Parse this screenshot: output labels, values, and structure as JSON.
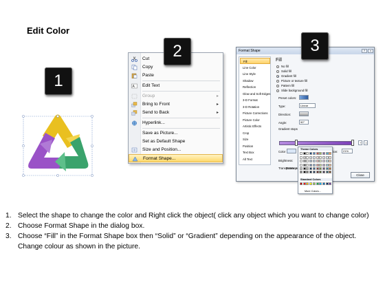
{
  "slide": {
    "title": "Edit Color"
  },
  "badges": [
    "1",
    "2",
    "3"
  ],
  "context_menu": {
    "items": [
      {
        "label": "Cut",
        "icon": "scissors-icon",
        "ul": true,
        "submenu": false,
        "disabled": false,
        "highlighted": false
      },
      {
        "label": "Copy",
        "icon": "copy-icon",
        "submenu": false,
        "disabled": false,
        "highlighted": false
      },
      {
        "label": "Paste",
        "icon": "paste-icon",
        "submenu": false,
        "disabled": false,
        "highlighted": false
      },
      {
        "label": "Edit Text",
        "icon": "edit-text-icon",
        "submenu": false,
        "disabled": false,
        "highlighted": false
      },
      {
        "label": "Group",
        "icon": "group-icon",
        "submenu": true,
        "disabled": true,
        "highlighted": false
      },
      {
        "label": "Bring to Front",
        "icon": "bring-to-front-icon",
        "submenu": true,
        "disabled": false,
        "highlighted": false
      },
      {
        "label": "Send to Back",
        "icon": "send-to-back-icon",
        "submenu": true,
        "disabled": false,
        "highlighted": false
      },
      {
        "label": "Hyperlink...",
        "icon": "hyperlink-icon",
        "submenu": false,
        "disabled": false,
        "highlighted": false
      },
      {
        "label": "Save as Picture...",
        "icon": "",
        "submenu": false,
        "disabled": false,
        "highlighted": false
      },
      {
        "label": "Set as Default Shape",
        "icon": "",
        "submenu": false,
        "disabled": false,
        "highlighted": false
      },
      {
        "label": "Size and Position...",
        "icon": "size-position-icon",
        "submenu": false,
        "disabled": false,
        "highlighted": false
      },
      {
        "label": "Format Shape...",
        "icon": "format-shape-icon",
        "submenu": false,
        "disabled": false,
        "highlighted": true
      }
    ]
  },
  "format_dialog": {
    "title": "Format Shape",
    "nav": [
      "Fill",
      "Line Color",
      "Line Style",
      "Shadow",
      "Reflection",
      "Glow and Soft Edges",
      "3-D Format",
      "3-D Rotation",
      "Picture Corrections",
      "Picture Color",
      "Artistic Effects",
      "Crop",
      "Size",
      "Position",
      "Text Box",
      "Alt Text"
    ],
    "nav_selected": 0,
    "heading": "Fill",
    "fill_options": [
      "No fill",
      "Solid fill",
      "Gradient fill",
      "Picture or texture fill",
      "Pattern fill",
      "Slide background fill"
    ],
    "fill_selected": 2,
    "labels": {
      "preset": "Preset colors:",
      "type": "Type:",
      "type_value": "Linear",
      "direction": "Direction:",
      "angle": "Angle:",
      "angle_value": "90°",
      "gradient_stops": "Gradient stops",
      "color": "Color",
      "position": "Position:",
      "position_value": "21%",
      "brightness": "Brightness:",
      "transparency": "Transparency:",
      "rotate": "Rotate with shape",
      "close": "Close"
    }
  },
  "theme_palette": {
    "theme_header": "Theme Colors",
    "standard_header": "Standard Colors",
    "more": "More Colors...",
    "theme_top": [
      "#ffffff",
      "#000000",
      "#eeece1",
      "#1f497d",
      "#4f81bd",
      "#c0504d",
      "#9bbb59",
      "#8064a2",
      "#4bacc6",
      "#f79646"
    ],
    "standard": [
      "#c00000",
      "#ff0000",
      "#ffc000",
      "#ffff00",
      "#92d050",
      "#00b050",
      "#00b0f0",
      "#0070c0",
      "#002060",
      "#7030a0"
    ]
  },
  "instructions": [
    {
      "num": "1.",
      "text": "Select the shape to change the color and Right click the object( click any object which you want to change color)"
    },
    {
      "num": "2.",
      "text": "Choose Format Shape in the dialog box."
    },
    {
      "num": "3.",
      "text": "Choose “Fill” in the Format Shape box then “Solid” or “Gradient” depending on the appearance of the object. Change colour as shown in the picture."
    }
  ],
  "colors": {
    "purple": "#9a52c7",
    "yellow": "#e9c020",
    "green": "#3aa36c",
    "highlight": "#ffd86a"
  }
}
